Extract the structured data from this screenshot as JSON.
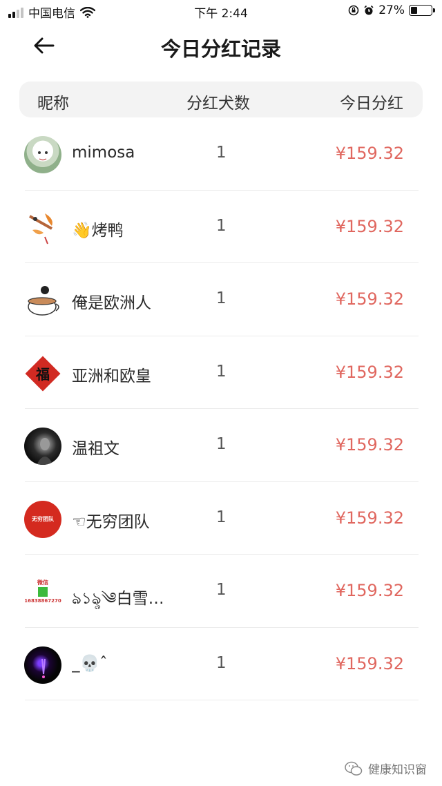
{
  "status_bar": {
    "carrier": "中国电信",
    "time": "下午 2:44",
    "battery": "27%",
    "battery_level": 0.27
  },
  "header": {
    "title": "今日分红记录"
  },
  "table": {
    "columns": [
      "昵称",
      "分红犬数",
      "今日分红"
    ],
    "rows": [
      {
        "nickname": "mimosa",
        "count": "1",
        "amount": "¥159.32"
      },
      {
        "nickname": "👋烤鸭",
        "count": "1",
        "amount": "¥159.32"
      },
      {
        "nickname": "俺是欧洲人",
        "count": "1",
        "amount": "¥159.32"
      },
      {
        "nickname": "亚洲和欧皇",
        "count": "1",
        "amount": "¥159.32"
      },
      {
        "nickname": "温祖文",
        "count": "1",
        "amount": "¥159.32"
      },
      {
        "nickname": "☜无穷团队",
        "count": "1",
        "amount": "¥159.32"
      },
      {
        "nickname": "ঌ১ৡ༄白雪…",
        "count": "1",
        "amount": "¥159.32"
      },
      {
        "nickname": "_💀ˆ",
        "count": "1",
        "amount": "¥159.32"
      }
    ]
  },
  "avatars": {
    "row4_char": "福",
    "row6_line1": "无穷团队",
    "row7_line1": "微信",
    "row7_line2": "16838867270"
  },
  "watermark": {
    "text": "健康知识窗"
  },
  "colors": {
    "amount": "#e0675f",
    "header_bg": "#f3f3f3"
  }
}
